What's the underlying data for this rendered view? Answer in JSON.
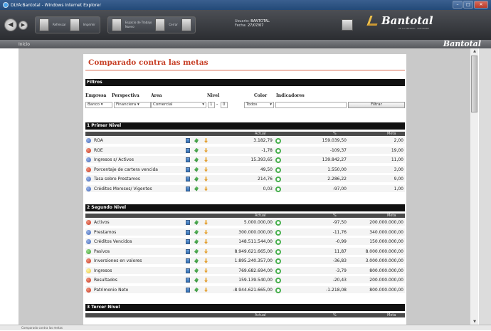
{
  "window": {
    "title": "DLYA:Bantotal - Windows Internet Explorer"
  },
  "toolbar": {
    "group1_labels": [
      "Refrescar",
      "Imprimir"
    ],
    "group2_labels": [
      "Espacio de Trabajo",
      "Nuevo",
      "Cerrar"
    ],
    "usuario_label": "Usuario:",
    "usuario_value": "BANTOTAL",
    "fecha_label": "Fecha:",
    "fecha_value": "27/07/07"
  },
  "brand": {
    "logo": "Bantotal",
    "tagline": "DE LA ENTIDAD · SOFTWARE"
  },
  "menu": {
    "inicio": "Inicio",
    "logo": "Bantotal"
  },
  "page": {
    "title": "Comparado contra las metas"
  },
  "filters": {
    "header": "Filtros",
    "labels": {
      "empresa": "Empresa",
      "perspectiva": "Perspectiva",
      "area": "Area",
      "nivel": "Nivel",
      "color": "Color",
      "indicadores": "Indicadores"
    },
    "values": {
      "empresa": "Banco",
      "perspectiva": "Financiera",
      "area": "Comercial",
      "nivel_from": "1",
      "nivel_sep": "-",
      "nivel_to": "0",
      "color": "Todos",
      "indicadores": ""
    },
    "button": "Filtrar"
  },
  "columns": {
    "actual": "Actual",
    "pct": "%",
    "meta": "Meta"
  },
  "sections": [
    {
      "title": "1 Primer Nivel",
      "rows": [
        {
          "name": "ROA",
          "status": "blue",
          "actual": "3.182,79",
          "pct": "159.039,50",
          "meta": "2,00"
        },
        {
          "name": "ROE",
          "status": "red",
          "actual": "-1,78",
          "pct": "-109,37",
          "meta": "19,00"
        },
        {
          "name": "Ingresos s/ Activos",
          "status": "blue",
          "actual": "15.393,65",
          "pct": "139.842,27",
          "meta": "11,00"
        },
        {
          "name": "Porcentaje de cartera vencida",
          "status": "red",
          "actual": "49,50",
          "pct": "1.550,00",
          "meta": "3,00"
        },
        {
          "name": "Tasa sobre Prestamos",
          "status": "blue",
          "actual": "214,76",
          "pct": "2.286,22",
          "meta": "9,00"
        },
        {
          "name": "Créditos Morosos/ Vigentes",
          "status": "blue",
          "actual": "0,03",
          "pct": "-97,00",
          "meta": "1,00"
        }
      ]
    },
    {
      "title": "2 Segundo Nivel",
      "rows": [
        {
          "name": "Activos",
          "status": "red",
          "actual": "5.000.000,00",
          "pct": "-97,50",
          "meta": "200.000.000,00"
        },
        {
          "name": "Prestamos",
          "status": "blue",
          "actual": "300.000.000,00",
          "pct": "-11,76",
          "meta": "340.000.000,00"
        },
        {
          "name": "Créditos Vencidos",
          "status": "blue",
          "actual": "148.511.544,00",
          "pct": "-0,99",
          "meta": "150.000.000,00"
        },
        {
          "name": "Pasivos",
          "status": "green",
          "actual": "8.949.621.665,00",
          "pct": "11,87",
          "meta": "8.000.000.000,00"
        },
        {
          "name": "Inversiones en valores",
          "status": "red",
          "actual": "1.895.240.357,00",
          "pct": "-36,83",
          "meta": "3.000.000.000,00"
        },
        {
          "name": "Ingresos",
          "status": "yellow",
          "actual": "769.682.694,00",
          "pct": "-3,79",
          "meta": "800.000.000,00"
        },
        {
          "name": "Resultados",
          "status": "red",
          "actual": "159.139.540,00",
          "pct": "-20,43",
          "meta": "200.000.000,00"
        },
        {
          "name": "Patrimonio Neto",
          "status": "red",
          "actual": "-8.944.621.665,00",
          "pct": "-1.218,08",
          "meta": "800.000.000,00"
        }
      ]
    },
    {
      "title": "3 Tercer Nivel",
      "rows": []
    }
  ],
  "statusbar": {
    "text": "Comparado contra las metas"
  }
}
